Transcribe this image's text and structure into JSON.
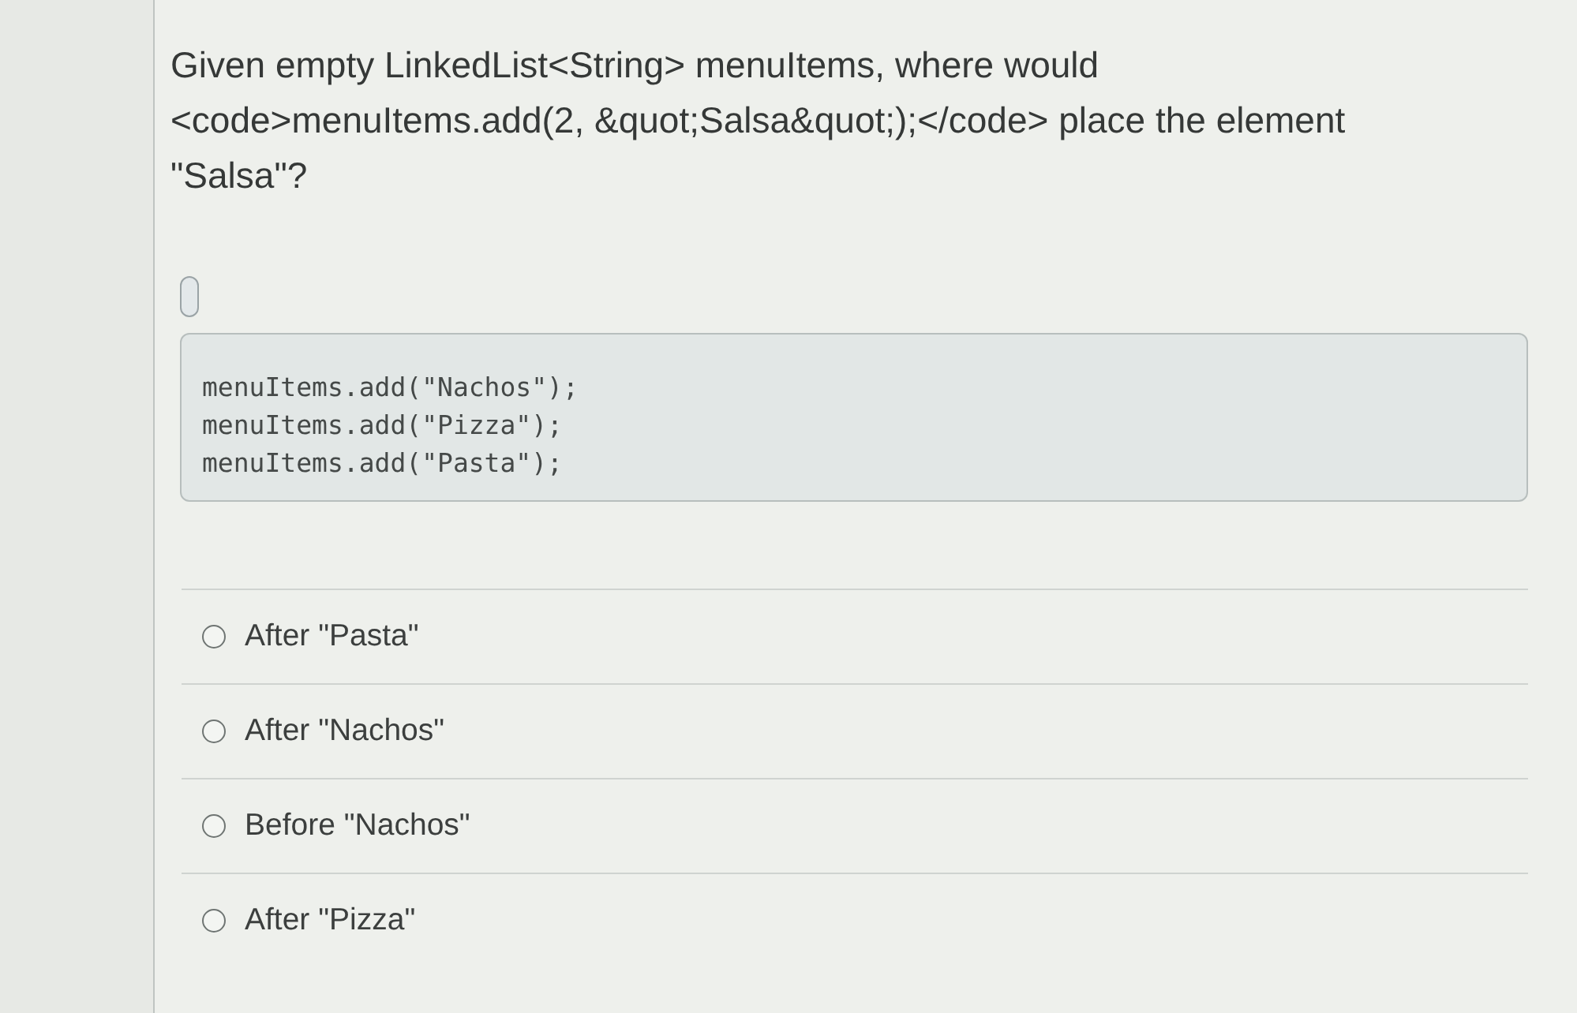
{
  "question": {
    "text": "Given empty LinkedList<String> menuItems, where would <code>menuItems.add(2, &quot;Salsa&quot;);</code> place the element \"Salsa\"?"
  },
  "code": {
    "lines": [
      "menuItems.add(\"Nachos\");",
      "menuItems.add(\"Pizza\");",
      "menuItems.add(\"Pasta\");"
    ]
  },
  "options": [
    {
      "label": "After \"Pasta\"",
      "selected": false
    },
    {
      "label": "After \"Nachos\"",
      "selected": false
    },
    {
      "label": "Before \"Nachos\"",
      "selected": false
    },
    {
      "label": "After \"Pizza\"",
      "selected": false
    }
  ]
}
